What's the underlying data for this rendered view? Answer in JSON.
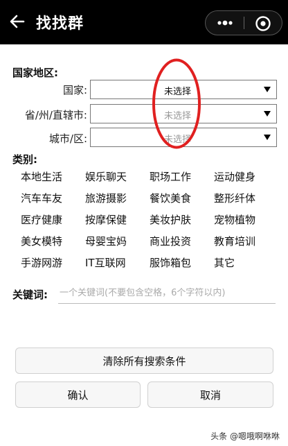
{
  "header": {
    "title": "找找群",
    "icons": {
      "back": "back-arrow-icon",
      "more": "more-dots-icon",
      "close": "target-circle-icon"
    }
  },
  "region": {
    "section_label": "国家地区:",
    "fields": [
      {
        "label": "国家:",
        "value": "未选择"
      },
      {
        "label": "省/州/直辖市:",
        "value": "未选择"
      },
      {
        "label": "城市/区:",
        "value": "未选择"
      }
    ],
    "highlight_color": "#e02020"
  },
  "category": {
    "section_label": "类别:",
    "items": [
      "本地生活",
      "娱乐聊天",
      "职场工作",
      "运动健身",
      "汽车车友",
      "旅游摄影",
      "餐饮美食",
      "整形纤体",
      "医疗健康",
      "按摩保健",
      "美妆护肤",
      "宠物植物",
      "美女模特",
      "母婴宝妈",
      "商业投资",
      "教育培训",
      "手游网游",
      "IT互联网",
      "服饰箱包",
      "其它"
    ]
  },
  "keyword": {
    "label": "关键词:",
    "placeholder": "一个关键词(不要包含空格，6个字符以内)"
  },
  "buttons": {
    "clear": "清除所有搜索条件",
    "confirm": "确认",
    "cancel": "取消"
  },
  "watermark": "头条 @嗯哦啊咻咻"
}
